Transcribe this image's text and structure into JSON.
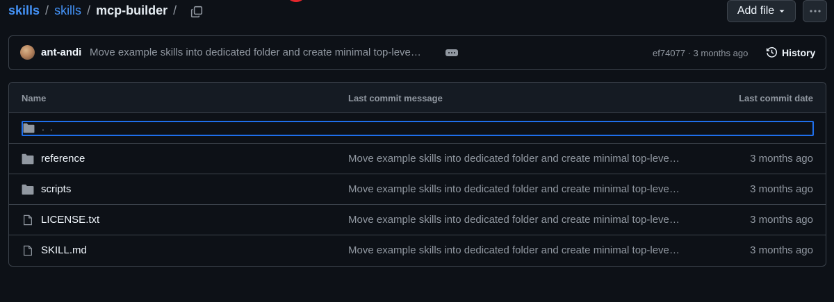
{
  "breadcrumb": {
    "items": [
      {
        "label": "skills"
      },
      {
        "label": "skills"
      }
    ],
    "current": "mcp-builder",
    "separator": "/"
  },
  "toolbar": {
    "add_file_label": "Add file",
    "more_label": "More options"
  },
  "latest_commit": {
    "author": "ant-andi",
    "message": "Move example skills into dedicated folder and create minimal top-leve…",
    "sha_time": "ef74077 · 3 months ago",
    "history_label": "History"
  },
  "table": {
    "headers": {
      "name": "Name",
      "message": "Last commit message",
      "date": "Last commit date"
    },
    "parent_label": ". .",
    "rows": [
      {
        "type": "folder",
        "name": "reference",
        "message": "Move example skills into dedicated folder and create minimal top-leve…",
        "date": "3 months ago"
      },
      {
        "type": "folder",
        "name": "scripts",
        "message": "Move example skills into dedicated folder and create minimal top-leve…",
        "date": "3 months ago"
      },
      {
        "type": "file",
        "name": "LICENSE.txt",
        "message": "Move example skills into dedicated folder and create minimal top-leve…",
        "date": "3 months ago"
      },
      {
        "type": "file",
        "name": "SKILL.md",
        "message": "Move example skills into dedicated folder and create minimal top-leve…",
        "date": "3 months ago"
      }
    ]
  },
  "colors": {
    "background": "#0d1117",
    "link": "#4493f8",
    "border": "#3d444d",
    "muted": "#9198a1",
    "focus": "#1f6feb",
    "red_marker": "#e5262c"
  },
  "icons": [
    "copy-icon",
    "caret-down-icon",
    "kebab-icon",
    "history-icon",
    "folder-icon",
    "file-icon"
  ]
}
